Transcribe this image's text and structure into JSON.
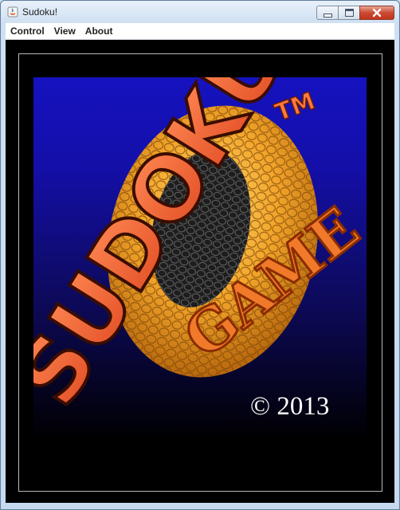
{
  "window": {
    "title": "Sudoku!"
  },
  "menu": {
    "items": [
      "Control",
      "View",
      "About"
    ]
  },
  "splash": {
    "logo_word_1": "SUDOKU",
    "logo_word_2": "GAME",
    "trademark": "TM",
    "copyright_text": "© 2013"
  }
}
